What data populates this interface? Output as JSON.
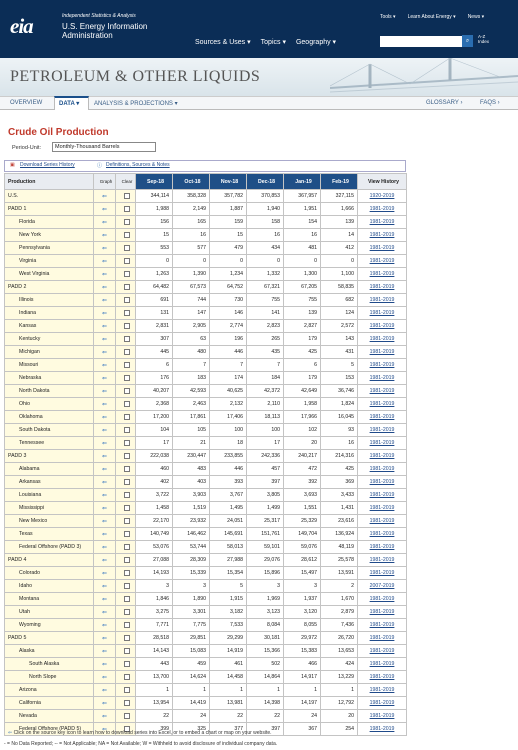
{
  "header": {
    "logo": "eia",
    "tagline": "Independent Statistics & Analysis",
    "agency": "U.S. Energy Information Administration",
    "topnav": [
      "Tools ▾",
      "Learn About Energy ▾",
      "News ▾"
    ],
    "mainnav": [
      "Sources & Uses ▾",
      "Topics ▾",
      "Geography ▾"
    ],
    "search_button": "⌕",
    "atoz": "A-Z\nIndex"
  },
  "banner": {
    "title": "PETROLEUM & OTHER LIQUIDS"
  },
  "subnav": {
    "overview": "OVERVIEW",
    "data": "DATA ▾",
    "analysis": "ANALYSIS & PROJECTIONS ▾",
    "glossary": "GLOSSARY ›",
    "faqs": "FAQS ›"
  },
  "page": {
    "title": "Crude Oil Production",
    "period_label": "Period-Unit:",
    "period_value": "Monthly-Thousand Barrels",
    "link_download": "Download Series History",
    "link_definitions": "Definitions, Sources & Notes"
  },
  "table": {
    "header_product": "Production",
    "header_graph": "Graph",
    "header_clear": "Clear",
    "months": [
      "Sep-18",
      "Oct-18",
      "Nov-18",
      "Dec-18",
      "Jan-19",
      "Feb-19"
    ],
    "header_history": "View History",
    "rows": [
      {
        "name": "U.S.",
        "indent": 0,
        "v": [
          "344,114",
          "358,328",
          "357,782",
          "370,853",
          "367,957",
          "327,115"
        ],
        "h": "1920-2019"
      },
      {
        "name": "PADD 1",
        "indent": 0,
        "v": [
          "1,988",
          "2,149",
          "1,887",
          "1,940",
          "1,951",
          "1,666"
        ],
        "h": "1981-2019"
      },
      {
        "name": "Florida",
        "indent": 1,
        "v": [
          "156",
          "165",
          "159",
          "158",
          "154",
          "139"
        ],
        "h": "1981-2019"
      },
      {
        "name": "New York",
        "indent": 1,
        "v": [
          "15",
          "16",
          "15",
          "16",
          "16",
          "14"
        ],
        "h": "1981-2019"
      },
      {
        "name": "Pennsylvania",
        "indent": 1,
        "v": [
          "553",
          "577",
          "479",
          "434",
          "481",
          "412"
        ],
        "h": "1981-2019"
      },
      {
        "name": "Virginia",
        "indent": 1,
        "v": [
          "0",
          "0",
          "0",
          "0",
          "0",
          "0"
        ],
        "h": "1981-2019"
      },
      {
        "name": "West Virginia",
        "indent": 1,
        "v": [
          "1,263",
          "1,390",
          "1,234",
          "1,332",
          "1,300",
          "1,100"
        ],
        "h": "1981-2019"
      },
      {
        "name": "PADD 2",
        "indent": 0,
        "v": [
          "64,482",
          "67,573",
          "64,752",
          "67,321",
          "67,205",
          "58,835"
        ],
        "h": "1981-2019"
      },
      {
        "name": "Illinois",
        "indent": 1,
        "v": [
          "691",
          "744",
          "730",
          "755",
          "755",
          "682"
        ],
        "h": "1981-2019"
      },
      {
        "name": "Indiana",
        "indent": 1,
        "v": [
          "131",
          "147",
          "146",
          "141",
          "139",
          "124"
        ],
        "h": "1981-2019"
      },
      {
        "name": "Kansas",
        "indent": 1,
        "v": [
          "2,831",
          "2,905",
          "2,774",
          "2,823",
          "2,827",
          "2,572"
        ],
        "h": "1981-2019"
      },
      {
        "name": "Kentucky",
        "indent": 1,
        "v": [
          "307",
          "63",
          "196",
          "265",
          "179",
          "143"
        ],
        "h": "1981-2019"
      },
      {
        "name": "Michigan",
        "indent": 1,
        "v": [
          "445",
          "480",
          "446",
          "435",
          "425",
          "431"
        ],
        "h": "1981-2019"
      },
      {
        "name": "Missouri",
        "indent": 1,
        "v": [
          "6",
          "7",
          "7",
          "7",
          "6",
          "5"
        ],
        "h": "1981-2019"
      },
      {
        "name": "Nebraska",
        "indent": 1,
        "v": [
          "176",
          "183",
          "174",
          "184",
          "179",
          "153"
        ],
        "h": "1981-2019"
      },
      {
        "name": "North Dakota",
        "indent": 1,
        "v": [
          "40,207",
          "42,593",
          "40,625",
          "42,372",
          "42,649",
          "36,746"
        ],
        "h": "1981-2019"
      },
      {
        "name": "Ohio",
        "indent": 1,
        "v": [
          "2,368",
          "2,463",
          "2,132",
          "2,110",
          "1,958",
          "1,824"
        ],
        "h": "1981-2019"
      },
      {
        "name": "Oklahoma",
        "indent": 1,
        "v": [
          "17,200",
          "17,861",
          "17,406",
          "18,113",
          "17,966",
          "16,045"
        ],
        "h": "1981-2019"
      },
      {
        "name": "South Dakota",
        "indent": 1,
        "v": [
          "104",
          "105",
          "100",
          "100",
          "102",
          "93"
        ],
        "h": "1981-2019"
      },
      {
        "name": "Tennessee",
        "indent": 1,
        "v": [
          "17",
          "21",
          "18",
          "17",
          "20",
          "16"
        ],
        "h": "1981-2019"
      },
      {
        "name": "PADD 3",
        "indent": 0,
        "v": [
          "222,038",
          "230,447",
          "233,855",
          "242,336",
          "240,217",
          "214,316"
        ],
        "h": "1981-2019"
      },
      {
        "name": "Alabama",
        "indent": 1,
        "v": [
          "460",
          "483",
          "446",
          "457",
          "472",
          "425"
        ],
        "h": "1981-2019"
      },
      {
        "name": "Arkansas",
        "indent": 1,
        "v": [
          "402",
          "403",
          "393",
          "397",
          "392",
          "369"
        ],
        "h": "1981-2019"
      },
      {
        "name": "Louisiana",
        "indent": 1,
        "v": [
          "3,722",
          "3,903",
          "3,767",
          "3,805",
          "3,693",
          "3,433"
        ],
        "h": "1981-2019"
      },
      {
        "name": "Mississippi",
        "indent": 1,
        "v": [
          "1,458",
          "1,519",
          "1,495",
          "1,499",
          "1,551",
          "1,431"
        ],
        "h": "1981-2019"
      },
      {
        "name": "New Mexico",
        "indent": 1,
        "v": [
          "22,170",
          "23,932",
          "24,051",
          "25,317",
          "25,329",
          "23,616"
        ],
        "h": "1981-2019"
      },
      {
        "name": "Texas",
        "indent": 1,
        "v": [
          "140,749",
          "146,462",
          "145,691",
          "151,761",
          "149,704",
          "136,924"
        ],
        "h": "1981-2019"
      },
      {
        "name": "Federal Offshore (PADD 3)",
        "indent": 1,
        "v": [
          "53,076",
          "53,744",
          "58,013",
          "59,101",
          "59,076",
          "48,119"
        ],
        "h": "1981-2019"
      },
      {
        "name": "PADD 4",
        "indent": 0,
        "v": [
          "27,088",
          "28,309",
          "27,988",
          "29,076",
          "28,612",
          "25,578"
        ],
        "h": "1981-2019"
      },
      {
        "name": "Colorado",
        "indent": 1,
        "v": [
          "14,193",
          "15,339",
          "15,354",
          "15,896",
          "15,497",
          "13,591"
        ],
        "h": "1981-2019"
      },
      {
        "name": "Idaho",
        "indent": 1,
        "v": [
          "3",
          "3",
          "5",
          "3",
          "3",
          "2"
        ],
        "h": "2007-2019"
      },
      {
        "name": "Montana",
        "indent": 1,
        "v": [
          "1,846",
          "1,890",
          "1,915",
          "1,969",
          "1,937",
          "1,670"
        ],
        "h": "1981-2019"
      },
      {
        "name": "Utah",
        "indent": 1,
        "v": [
          "3,275",
          "3,301",
          "3,182",
          "3,123",
          "3,120",
          "2,879"
        ],
        "h": "1981-2019"
      },
      {
        "name": "Wyoming",
        "indent": 1,
        "v": [
          "7,771",
          "7,775",
          "7,533",
          "8,084",
          "8,055",
          "7,436"
        ],
        "h": "1981-2019"
      },
      {
        "name": "PADD 5",
        "indent": 0,
        "v": [
          "28,518",
          "29,851",
          "29,299",
          "30,181",
          "29,972",
          "26,720"
        ],
        "h": "1981-2019"
      },
      {
        "name": "Alaska",
        "indent": 1,
        "v": [
          "14,143",
          "15,083",
          "14,919",
          "15,366",
          "15,383",
          "13,653"
        ],
        "h": "1981-2019"
      },
      {
        "name": "South Alaska",
        "indent": 2,
        "v": [
          "443",
          "459",
          "461",
          "502",
          "466",
          "424"
        ],
        "h": "1981-2019"
      },
      {
        "name": "North Slope",
        "indent": 2,
        "v": [
          "13,700",
          "14,624",
          "14,458",
          "14,864",
          "14,917",
          "13,229"
        ],
        "h": "1981-2019"
      },
      {
        "name": "Arizona",
        "indent": 1,
        "v": [
          "1",
          "1",
          "1",
          "1",
          "1",
          "1"
        ],
        "h": "1981-2019"
      },
      {
        "name": "California",
        "indent": 1,
        "v": [
          "13,954",
          "14,419",
          "13,981",
          "14,398",
          "14,197",
          "12,792"
        ],
        "h": "1981-2019"
      },
      {
        "name": "Nevada",
        "indent": 1,
        "v": [
          "22",
          "24",
          "22",
          "22",
          "24",
          "20"
        ],
        "h": "1981-2019"
      },
      {
        "name": "Federal Offshore (PADD 5)",
        "indent": 1,
        "v": [
          "399",
          "325",
          "377",
          "397",
          "367",
          "254"
        ],
        "h": "1981-2019"
      }
    ]
  },
  "footer": {
    "note1": "Click on the source key icon to learn how to download series into Excel, or to embed a chart or map on your website.",
    "note2": "- = No Data Reported;  -- = Not Applicable;  NA = Not Available;  W = Withheld to avoid disclosure of individual company data."
  }
}
